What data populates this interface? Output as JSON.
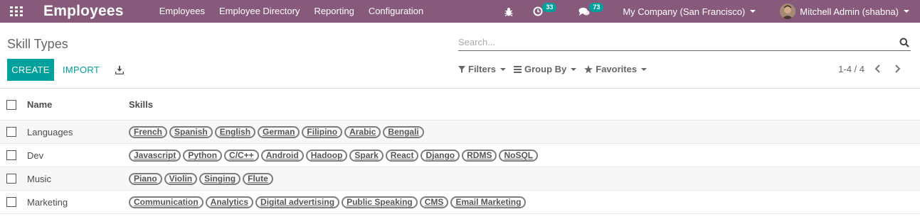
{
  "navbar": {
    "app_title": "Employees",
    "menu": [
      "Employees",
      "Employee Directory",
      "Reporting",
      "Configuration"
    ],
    "activity_count": "33",
    "messages_count": "73",
    "company": "My Company (San Francisco)",
    "user": "Mitchell Admin (shabna)"
  },
  "control_panel": {
    "breadcrumb": "Skill Types",
    "search_placeholder": "Search...",
    "create_label": "CREATE",
    "import_label": "IMPORT",
    "filters_label": "Filters",
    "groupby_label": "Group By",
    "favorites_label": "Favorites",
    "pager_text": "1-4 / 4"
  },
  "list": {
    "columns": {
      "name": "Name",
      "skills": "Skills"
    },
    "rows": [
      {
        "name": "Languages",
        "skills": [
          "French",
          "Spanish",
          "English",
          "German",
          "Filipino",
          "Arabic",
          "Bengali"
        ]
      },
      {
        "name": "Dev",
        "skills": [
          "Javascript",
          "Python",
          "C/C++",
          "Android",
          "Hadoop",
          "Spark",
          "React",
          "Django",
          "RDMS",
          "NoSQL"
        ]
      },
      {
        "name": "Music",
        "skills": [
          "Piano",
          "Violin",
          "Singing",
          "Flute"
        ]
      },
      {
        "name": "Marketing",
        "skills": [
          "Communication",
          "Analytics",
          "Digital advertising",
          "Public Speaking",
          "CMS",
          "Email Marketing"
        ]
      }
    ]
  },
  "colors": {
    "navbar": "#875a7b",
    "accent": "#00a09d"
  }
}
